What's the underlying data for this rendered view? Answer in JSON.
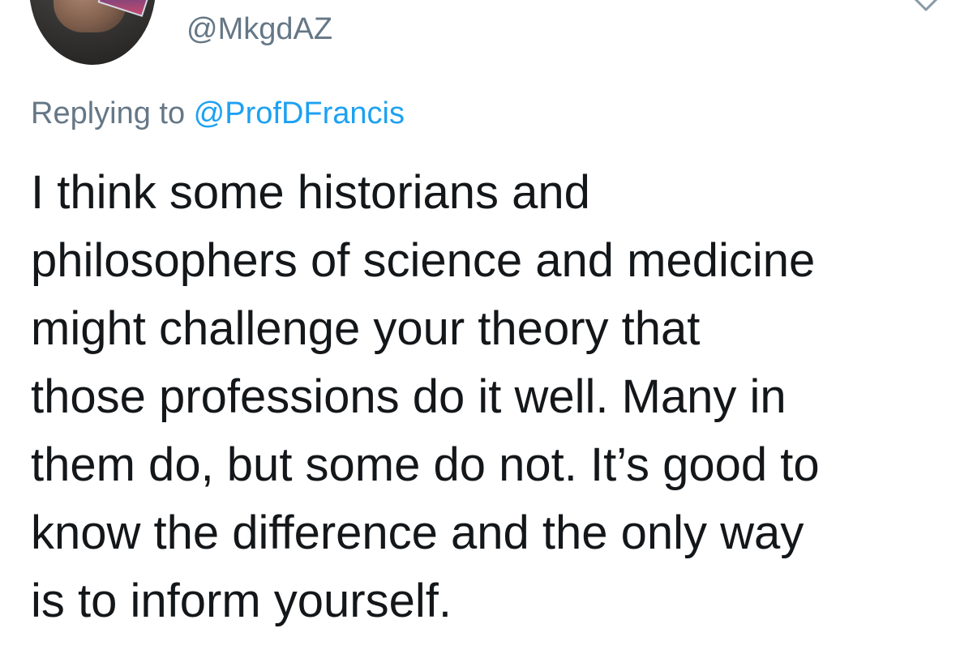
{
  "tweet": {
    "handle": "@MkgdAZ",
    "replying_prefix": "Replying to ",
    "replying_to": "@ProfDFrancis",
    "body_lines": [
      "I think some historians and",
      "philosophers of science and medicine",
      "might challenge your theory that",
      "those professions do it well. Many in",
      "them do, but some do not. It’s good to",
      "know the difference and the only way",
      "is to inform yourself."
    ]
  },
  "icons": {
    "more": "chevron-down-icon"
  },
  "colors": {
    "text": "#14171a",
    "secondary": "#657786",
    "link": "#1da1f2",
    "background": "#ffffff"
  }
}
